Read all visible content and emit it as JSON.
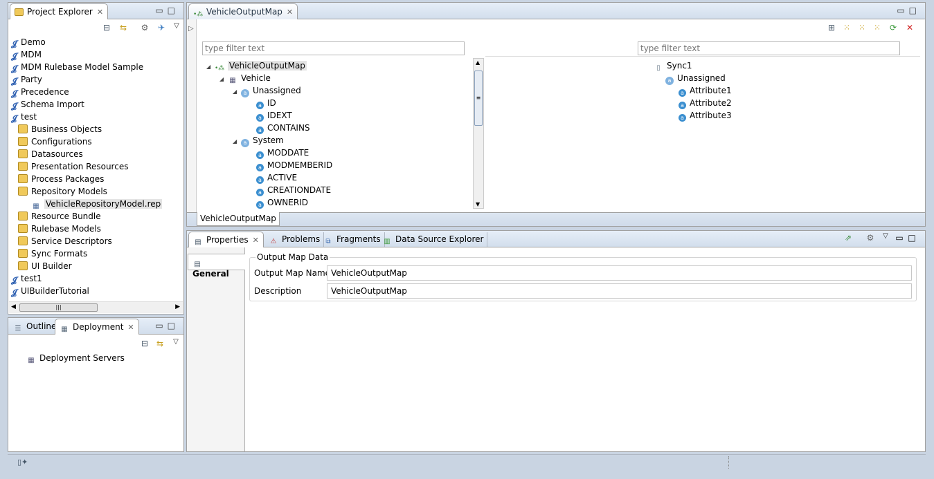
{
  "explorer": {
    "tab_label": "Project Explorer",
    "items": [
      {
        "label": "Demo",
        "type": "project"
      },
      {
        "label": "MDM",
        "type": "project"
      },
      {
        "label": "MDM Rulebase Model Sample",
        "type": "project"
      },
      {
        "label": "Party",
        "type": "project"
      },
      {
        "label": "Precedence",
        "type": "project"
      },
      {
        "label": "Schema Import",
        "type": "project"
      },
      {
        "label": "test",
        "type": "project"
      },
      {
        "label": "Business Objects",
        "type": "folder"
      },
      {
        "label": "Configurations",
        "type": "folder"
      },
      {
        "label": "Datasources",
        "type": "folder"
      },
      {
        "label": "Presentation Resources",
        "type": "folder"
      },
      {
        "label": "Process Packages",
        "type": "folder"
      },
      {
        "label": "Repository Models",
        "type": "folder"
      },
      {
        "label": "VehicleRepositoryModel.rep",
        "type": "file"
      },
      {
        "label": "Resource Bundle",
        "type": "folder"
      },
      {
        "label": "Rulebase Models",
        "type": "folder"
      },
      {
        "label": "Service Descriptors",
        "type": "folder"
      },
      {
        "label": "Sync Formats",
        "type": "folder"
      },
      {
        "label": "UI Builder",
        "type": "folder"
      },
      {
        "label": "test1",
        "type": "project"
      },
      {
        "label": "UIBuilderTutorial",
        "type": "project"
      }
    ]
  },
  "outline": {
    "outline_tab": "Outline",
    "deployment_tab": "Deployment",
    "items": [
      "Deployment Servers"
    ]
  },
  "editor": {
    "tab_label": "VehicleOutputMap",
    "bottom_tab": "VehicleOutputMap",
    "left_filter_placeholder": "type filter text",
    "right_filter_placeholder": "type filter text",
    "left_tree": {
      "root": "VehicleOutputMap",
      "entity": "Vehicle",
      "groups": [
        {
          "name": "Unassigned",
          "attrs": [
            "ID",
            "IDEXT",
            "CONTAINS"
          ]
        },
        {
          "name": "System",
          "attrs": [
            "MODDATE",
            "MODMEMBERID",
            "ACTIVE",
            "CREATIONDATE",
            "OWNERID"
          ]
        }
      ]
    },
    "right_tree": {
      "root": "Sync1",
      "group": "Unassigned",
      "attrs": [
        "Attribute1",
        "Attribute2",
        "Attribute3"
      ]
    }
  },
  "properties": {
    "tabs": [
      "Properties",
      "Problems",
      "Fragments",
      "Data Source Explorer"
    ],
    "side_tab": "General",
    "section_title": "Output Map Data",
    "fields": [
      {
        "label": "Output Map Name",
        "value": "VehicleOutputMap"
      },
      {
        "label": "Description",
        "value": "VehicleOutputMap"
      }
    ]
  },
  "colors": {
    "accent": "#3b8fd0",
    "folder": "#f0c95a",
    "close_red": "#d02020",
    "toolbar_green": "#3a9a3a"
  }
}
